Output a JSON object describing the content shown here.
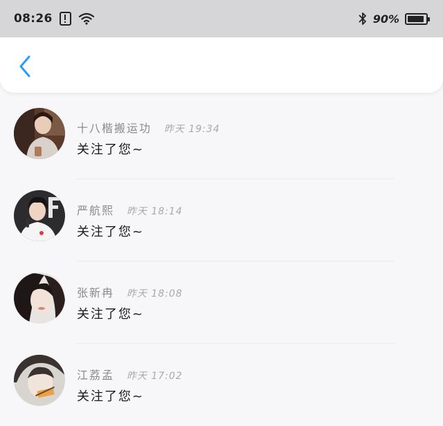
{
  "status_bar": {
    "time": "08:26",
    "battery_percent": "90%",
    "battery_level": 0.9,
    "icons": [
      "alert-icon",
      "wifi-icon",
      "bluetooth-icon",
      "battery-icon"
    ]
  },
  "nav": {
    "back_icon": "chevron-left-icon",
    "accent_color": "#2a9df4"
  },
  "notifications": [
    {
      "name": "十八楷搬运功",
      "day": "昨天",
      "time": "19:34",
      "message": "关注了您~"
    },
    {
      "name": "严航熙",
      "day": "昨天",
      "time": "18:14",
      "message": "关注了您~"
    },
    {
      "name": "张新冉",
      "day": "昨天",
      "time": "18:08",
      "message": "关注了您~"
    },
    {
      "name": "江荔孟",
      "day": "昨天",
      "time": "17:02",
      "message": "关注了您~"
    }
  ]
}
